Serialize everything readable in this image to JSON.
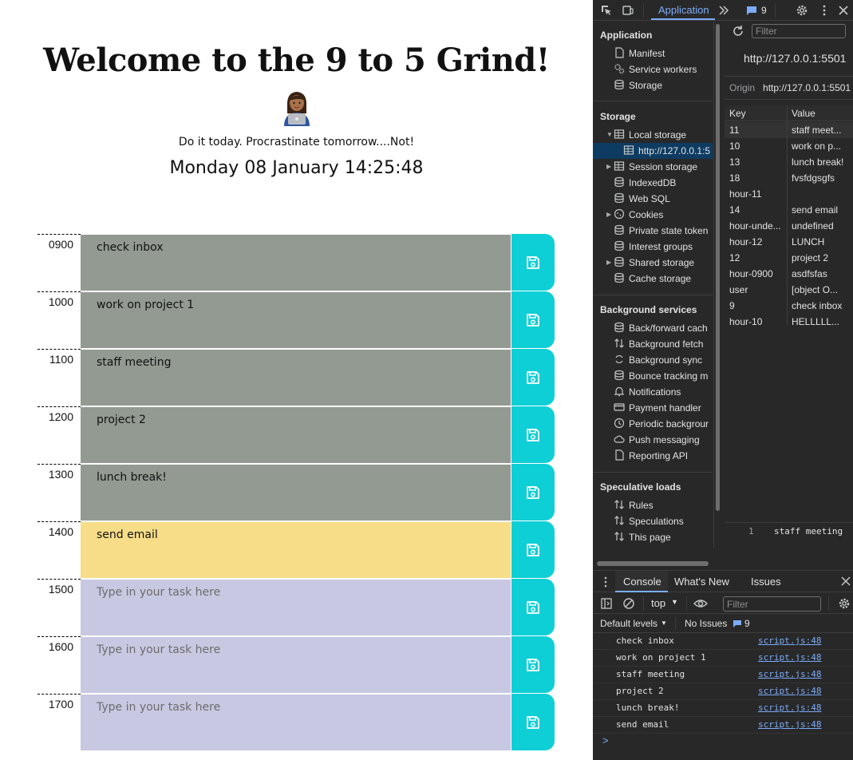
{
  "page": {
    "title": "Welcome to the 9 to 5 Grind!",
    "emoji_icon": "woman-technologist-emoji",
    "motto": "Do it today. Procrastinate tomorrow....Not!",
    "clock": "Monday 08 January 14:25:48",
    "task_placeholder": "Type in your task here",
    "colors": {
      "past": "#929a92",
      "present": "#f7dd88",
      "future": "#c8c8e2",
      "save": "#0fcfd6"
    },
    "rows": [
      {
        "hour": "0900",
        "task": "check inbox",
        "state": "past"
      },
      {
        "hour": "1000",
        "task": "work on project 1",
        "state": "past"
      },
      {
        "hour": "1100",
        "task": "staff meeting",
        "state": "past"
      },
      {
        "hour": "1200",
        "task": "project 2",
        "state": "past"
      },
      {
        "hour": "1300",
        "task": "lunch break!",
        "state": "past"
      },
      {
        "hour": "1400",
        "task": "send email",
        "state": "present"
      },
      {
        "hour": "1500",
        "task": "",
        "state": "future"
      },
      {
        "hour": "1600",
        "task": "",
        "state": "future"
      },
      {
        "hour": "1700",
        "task": "",
        "state": "future"
      }
    ]
  },
  "devtools": {
    "active_tab": "Application",
    "issues_count": "9",
    "sidebar": {
      "application_header": "Application",
      "application_items": [
        "Manifest",
        "Service workers",
        "Storage"
      ],
      "storage_header": "Storage",
      "local_storage": "Local storage",
      "local_storage_origin": "http://127.0.0.1:5",
      "storage_items": [
        "Session storage",
        "IndexedDB",
        "Web SQL",
        "Cookies",
        "Private state token",
        "Interest groups",
        "Shared storage",
        "Cache storage"
      ],
      "background_header": "Background services",
      "background_items": [
        "Back/forward cach",
        "Background fetch",
        "Background sync",
        "Bounce tracking m",
        "Notifications",
        "Payment handler",
        "Periodic backgrour",
        "Push messaging",
        "Reporting API"
      ],
      "speculative_header": "Speculative loads",
      "speculative_items": [
        "Rules",
        "Speculations",
        "This page"
      ]
    },
    "storage_view": {
      "filter_placeholder": "Filter",
      "url": "http://127.0.0.1:5501",
      "origin_label": "Origin",
      "origin_value": "http://127.0.0.1:5501",
      "columns": [
        "Key",
        "Value"
      ],
      "rows": [
        [
          "11",
          "staff meet..."
        ],
        [
          "10",
          "work on p..."
        ],
        [
          "13",
          "lunch break!"
        ],
        [
          "18",
          "fvsfdgsgfs"
        ],
        [
          "hour-11",
          ""
        ],
        [
          "14",
          "send email"
        ],
        [
          "hour-unde...",
          "undefined"
        ],
        [
          "hour-12",
          "LUNCH"
        ],
        [
          "12",
          "project 2"
        ],
        [
          "hour-0900",
          "asdfsfas"
        ],
        [
          "user",
          "[object O..."
        ],
        [
          "9",
          "check inbox"
        ],
        [
          "hour-10",
          "HELLLLL..."
        ]
      ],
      "preview_line": "1",
      "preview_value": "staff meeting"
    },
    "console": {
      "tabs": [
        "Console",
        "What's New",
        "Issues"
      ],
      "context": "top",
      "filter_placeholder": "Filter",
      "levels": "Default levels",
      "no_issues": "No Issues",
      "issues_count": "9",
      "logs": [
        {
          "msg": "check inbox",
          "src": "script.js:48"
        },
        {
          "msg": "work on project 1",
          "src": "script.js:48"
        },
        {
          "msg": "staff meeting",
          "src": "script.js:48"
        },
        {
          "msg": "project 2",
          "src": "script.js:48"
        },
        {
          "msg": "lunch break!",
          "src": "script.js:48"
        },
        {
          "msg": "send email",
          "src": "script.js:48"
        }
      ],
      "prompt": ">"
    }
  }
}
